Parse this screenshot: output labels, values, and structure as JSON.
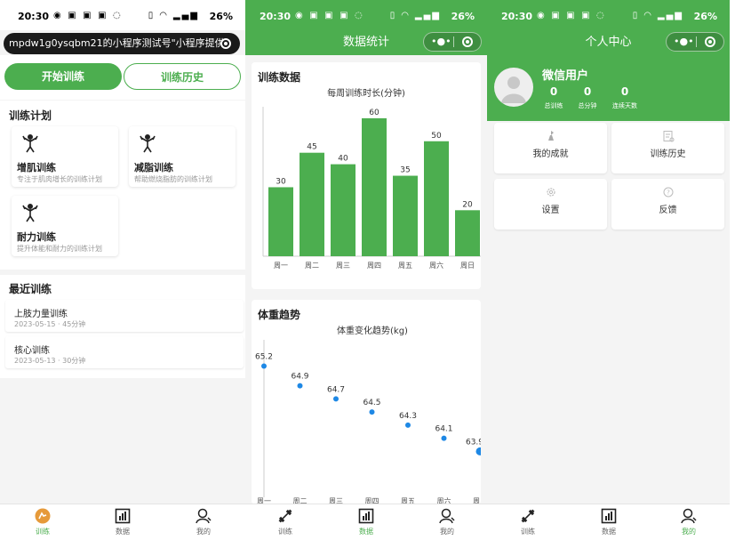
{
  "status": {
    "time": "20:30",
    "battery": "26%"
  },
  "panel1": {
    "url_text": "mpdw1g0ysqbm21的小程序测试号\"小程序提供",
    "tabs": {
      "start": "开始训练",
      "history": "训练历史"
    },
    "plan_title": "训练计划",
    "plans": [
      {
        "name": "增肌训练",
        "desc": "专注于肌肉增长的训练计划"
      },
      {
        "name": "减脂训练",
        "desc": "帮助燃烧脂肪的训练计划"
      },
      {
        "name": "耐力训练",
        "desc": "提升体能和耐力的训练计划"
      }
    ],
    "recent_title": "最近训练",
    "recent": [
      {
        "name": "上肢力量训练",
        "meta": "2023-05-15 · 45分钟"
      },
      {
        "name": "核心训练",
        "meta": "2023-05-13 · 30分钟"
      }
    ]
  },
  "panel2": {
    "nav_title": "数据统计",
    "training_title": "训练数据",
    "weight_title": "体重趋势"
  },
  "panel3": {
    "nav_title": "个人中心",
    "username": "微信用户",
    "stats": [
      {
        "value": "0",
        "label": "总训练"
      },
      {
        "value": "0",
        "label": "总分钟"
      },
      {
        "value": "0",
        "label": "连续天数"
      }
    ],
    "menu": [
      {
        "label": "我的成就"
      },
      {
        "label": "训练历史"
      },
      {
        "label": "设置"
      },
      {
        "label": "反馈"
      }
    ]
  },
  "tabbar": {
    "train": "训练",
    "data": "数据",
    "mine": "我的"
  },
  "colors": {
    "accent": "#4cae4f",
    "bar": "#4cae4f",
    "point": "#1e88e5"
  },
  "chart_data": [
    {
      "type": "bar",
      "title": "每周训练时长(分钟)",
      "categories": [
        "周一",
        "周二",
        "周三",
        "周四",
        "周五",
        "周六",
        "周日"
      ],
      "values": [
        30,
        45,
        40,
        60,
        35,
        50,
        20
      ],
      "ylim": [
        0,
        65
      ]
    },
    {
      "type": "scatter",
      "title": "体重变化趋势(kg)",
      "categories": [
        "周一",
        "周二",
        "周三",
        "周四",
        "周五",
        "周六",
        "周日"
      ],
      "values": [
        65.2,
        64.9,
        64.7,
        64.5,
        64.3,
        64.1,
        63.9
      ],
      "ylim": [
        63.2,
        65.6
      ]
    }
  ]
}
